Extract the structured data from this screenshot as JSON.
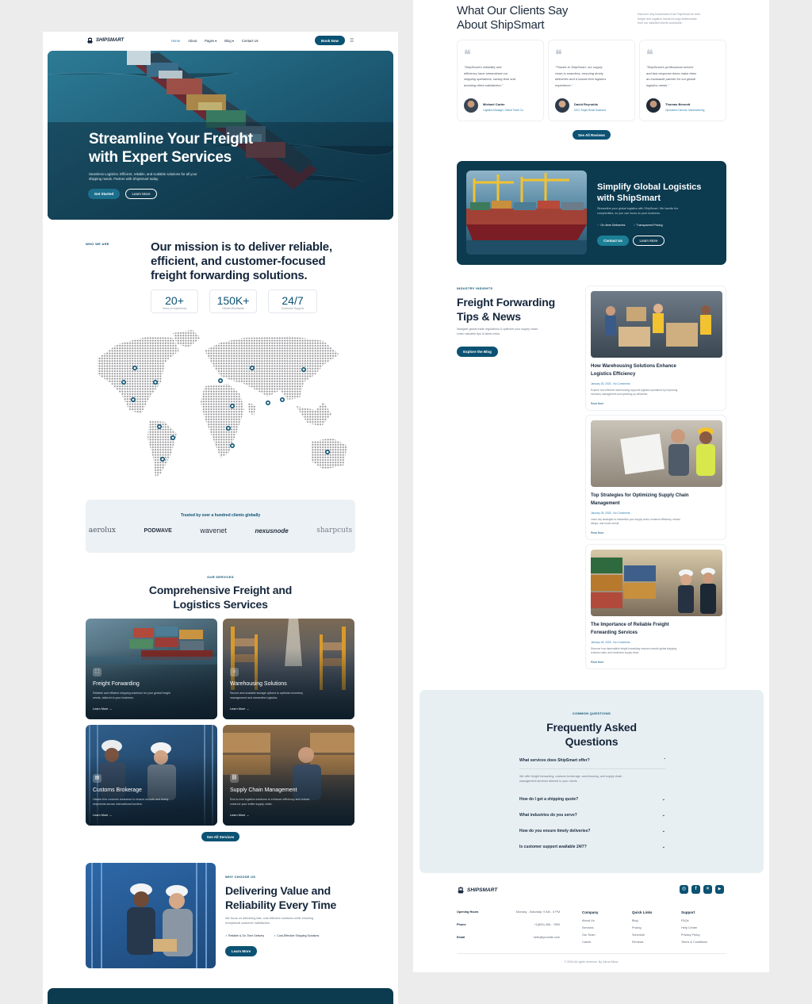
{
  "brand": "SHIPSMART",
  "nav": {
    "items": [
      "Home",
      "About",
      "Pages",
      "Blog",
      "Contact Us"
    ],
    "book": "Book Now"
  },
  "hero": {
    "title_l1": "Streamline Your Freight",
    "title_l2": "with Expert Services",
    "desc_l1": "Seamless Logistics. Efficient, reliable, and scalable solutions for all your",
    "desc_l2": "shipping needs. Partner with ShipSmart today.",
    "get_started": "Get Started",
    "learn_more": "Learn More"
  },
  "mission": {
    "eyebrow": "WHO WE ARE",
    "l1": "Our mission is to deliver reliable,",
    "l2": "efficient, and customer-focused",
    "l3": "freight forwarding solutions."
  },
  "stats": [
    {
      "value": "20+",
      "label": "Years of experience"
    },
    {
      "value": "150K+",
      "label": "Clients Worldwide"
    },
    {
      "value": "24/7",
      "label": "Customer Support"
    }
  ],
  "trusted": {
    "title": "Trusted by over a hundred clients globally",
    "logos": [
      "aerolux",
      "PODWAVE",
      "wavenet",
      "nexusnode",
      "sharpcuts"
    ]
  },
  "services": {
    "eyebrow": "OUR SERVICES",
    "l1": "Comprehensive Freight and",
    "l2": "Logistics Services",
    "learn": "Learn More →",
    "see_all": "See All Services",
    "items": [
      {
        "title": "Freight Forwarding",
        "d1": "Reliable and efficient shipping solutions for your global freight",
        "d2": "needs, tailored to your business."
      },
      {
        "title": "Warehousing Solutions",
        "d1": "Secure and scalable storage options to optimize inventory",
        "d2": "management and streamline logistics."
      },
      {
        "title": "Customs Brokerage",
        "d1": "Hassle-free customs clearance to ensure smooth and timely",
        "d2": "shipments across international borders."
      },
      {
        "title": "Supply Chain Management",
        "d1": "End-to-end logistics solutions to enhance efficiency and reduce",
        "d2": "costs for your entire supply chain."
      }
    ]
  },
  "why": {
    "eyebrow": "WHY CHOOSE US",
    "l1": "Delivering Value and",
    "l2": "Reliability Every Time",
    "d1": "We focus on delivering fast, cost-effective solutions while ensuring",
    "d2": "exceptional customer satisfaction.",
    "f1": "Reliable & On-Time Delivery",
    "f2": "Cost-Effective Shipping Solutions",
    "btn": "Learn More"
  },
  "testimonials": {
    "l1": "What Our Clients Say",
    "l2": "About ShipSmart",
    "side1": "Discover why businesses trust ShipSmart for their",
    "side2": "freight and logistics needs through testimonials",
    "side3": "from our satisfied clients worldwide.",
    "see_all": "See All Reviews",
    "items": [
      {
        "q1": "\"ShipSmart's reliability and",
        "q2": "efficiency have streamlined our",
        "q3": "shipping operations, saving time and",
        "q4": "boosting client satisfaction.\"",
        "name": "Michael Carter",
        "role": "Logistics Manager, Global Trade Co."
      },
      {
        "q1": "\"Thanks to ShipSmart, our supply",
        "q2": "chain is seamless, ensuring timely",
        "q3": "deliveries and a hassle-free logistics",
        "q4": "experience.\"",
        "name": "David Reynolds",
        "role": "CEO, Rapid Retail Solutions"
      },
      {
        "q1": "\"ShipSmart's professional service",
        "q2": "and fast response times make them",
        "q3": "an invaluable partner for our global",
        "q4": "logistics needs.\"",
        "name": "Thomas Bennett",
        "role": "Operations Director, Manufacturing"
      }
    ]
  },
  "cta": {
    "l1": "Simplify Global Logistics",
    "l2": "with ShipSmart",
    "d1": "Streamline your global logistics with ShipSmart. We handle the",
    "d2": "complexities, so you can focus on your business.",
    "f1": "On-time Deliveries",
    "f2": "Transparent Pricing",
    "contact": "Contact Us",
    "learn": "Learn More"
  },
  "blog": {
    "eyebrow": "INDUSTRY INSIGHTS",
    "l1": "Freight Forwarding",
    "l2": "Tips & News",
    "d1": "Navigate global trade regulations & optimize your supply chain.",
    "d2": "Learn valuable tips & latest news.",
    "btn": "Explore the Blog",
    "read": "Read More",
    "posts": [
      {
        "t1": "How Warehousing Solutions Enhance",
        "t2": "Logistics Efficiency",
        "meta": "January 28, 2025 - No Comments",
        "e1": "Explore how effective warehousing supports logistics operations by improving",
        "e2": "inventory management and speeding up deliveries."
      },
      {
        "t1": "Top Strategies for Optimizing Supply Chain",
        "t2": "Management",
        "meta": "January 28, 2025 - No Comments",
        "e1": "Learn key strategies to streamline your supply chain, enhance efficiency, reduce",
        "e2": "delays, and boost overall"
      },
      {
        "t1": "The Importance of Reliable Freight",
        "t2": "Forwarding Services",
        "meta": "January 28, 2025 - No Comments",
        "e1": "Discover how dependable freight forwarding ensures smooth global shipping,",
        "e2": "reduces costs, and minimizes supply chain"
      }
    ]
  },
  "faq": {
    "eyebrow": "COMMON QUESTIONS",
    "l1": "Frequently Asked",
    "l2": "Questions",
    "items": [
      {
        "q": "What services does ShipSmart offer?",
        "a1": "We offer freight forwarding, customs brokerage, warehousing, and supply chain",
        "a2": "management services tailored to your needs."
      },
      {
        "q": "How do I get a shipping quote?"
      },
      {
        "q": "What industries do you serve?"
      },
      {
        "q": "How do you ensure timely deliveries?"
      },
      {
        "q": "Is customer support available 24/7?"
      }
    ]
  },
  "footer": {
    "hours_l": "Opening Hours",
    "hours_v": "Monday - Saturday: 9 AM - 5 PM",
    "phone_l": "Phone",
    "phone_v": "+1(800) 456 - 7890",
    "email_l": "Email",
    "email_v": "hello@yoursite.com",
    "company": {
      "h": "Company",
      "items": [
        "About Us",
        "Services",
        "Our Team",
        "Career"
      ]
    },
    "quick": {
      "h": "Quick Links",
      "items": [
        "Blog",
        "Pricing",
        "Schedule",
        "Reviews"
      ]
    },
    "support": {
      "h": "Support",
      "items": [
        "FAQs",
        "Help Center",
        "Privacy Policy",
        "Terms & Conditions"
      ]
    },
    "copyright": "© 2025 All rights reserved. By Zarrat Mirza"
  },
  "colors": {
    "primary": "#0b5273",
    "dark": "#0c3a4f",
    "bg": "#ececed"
  }
}
